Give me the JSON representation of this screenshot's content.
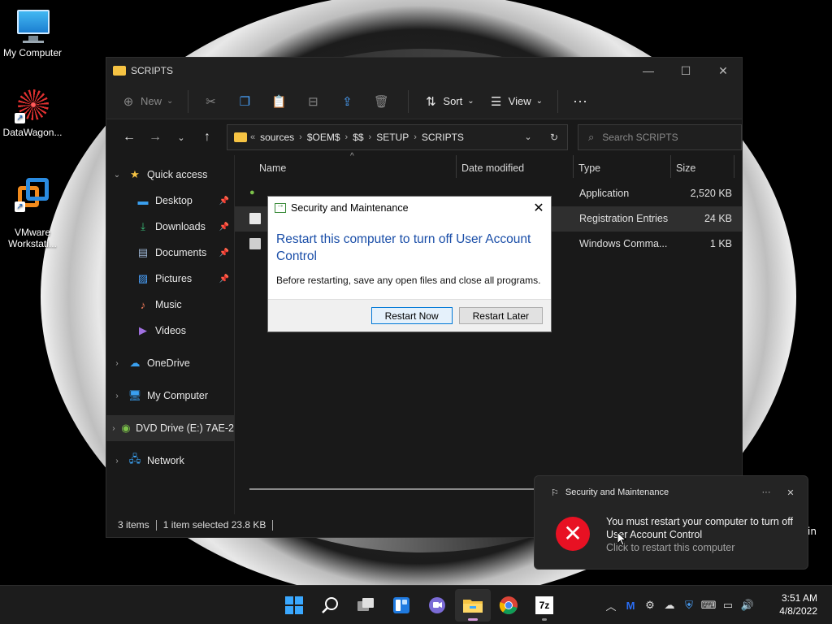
{
  "desktop": {
    "icons": [
      {
        "label": "My Computer"
      },
      {
        "label": "DataWagon..."
      },
      {
        "label": "VMware\nWorkstati..."
      }
    ]
  },
  "explorer": {
    "title": "SCRIPTS",
    "toolbar": {
      "new_label": "New",
      "sort_label": "Sort",
      "view_label": "View"
    },
    "address": {
      "overflow": "«",
      "crumbs": [
        "sources",
        "$OEM$",
        "$$",
        "SETUP",
        "SCRIPTS"
      ]
    },
    "search": {
      "placeholder": "Search SCRIPTS"
    },
    "nav": {
      "quick_access": "Quick access",
      "items": [
        "Desktop",
        "Downloads",
        "Documents",
        "Pictures",
        "Music",
        "Videos"
      ],
      "onedrive": "OneDrive",
      "my_computer": "My Computer",
      "dvd": "DVD Drive (E:) 7AE-2",
      "network": "Network"
    },
    "columns": {
      "name": "Name",
      "date": "Date modified",
      "type": "Type",
      "size": "Size"
    },
    "files": [
      {
        "type": "Application",
        "size": "2,520 KB"
      },
      {
        "type": "Registration Entries",
        "size": "24 KB"
      },
      {
        "type": "Windows Comma...",
        "size": "1 KB"
      }
    ],
    "status": {
      "items": "3 items",
      "selected": "1 item selected 23.8 KB"
    }
  },
  "dialog": {
    "title": "Security and Maintenance",
    "main": "Restart this computer to turn off User Account Control",
    "desc": "Before restarting, save any open files and close all programs.",
    "restart_now": "Restart Now",
    "restart_later": "Restart Later"
  },
  "toast": {
    "title": "Security and Maintenance",
    "message": "You must restart your computer to turn off User Account Control",
    "sub": "Click to restart this computer",
    "more": "···"
  },
  "behind_text": "in",
  "taskbar": {
    "time": "3:51 AM",
    "date": "4/8/2022",
    "sevenzip": "7z"
  }
}
